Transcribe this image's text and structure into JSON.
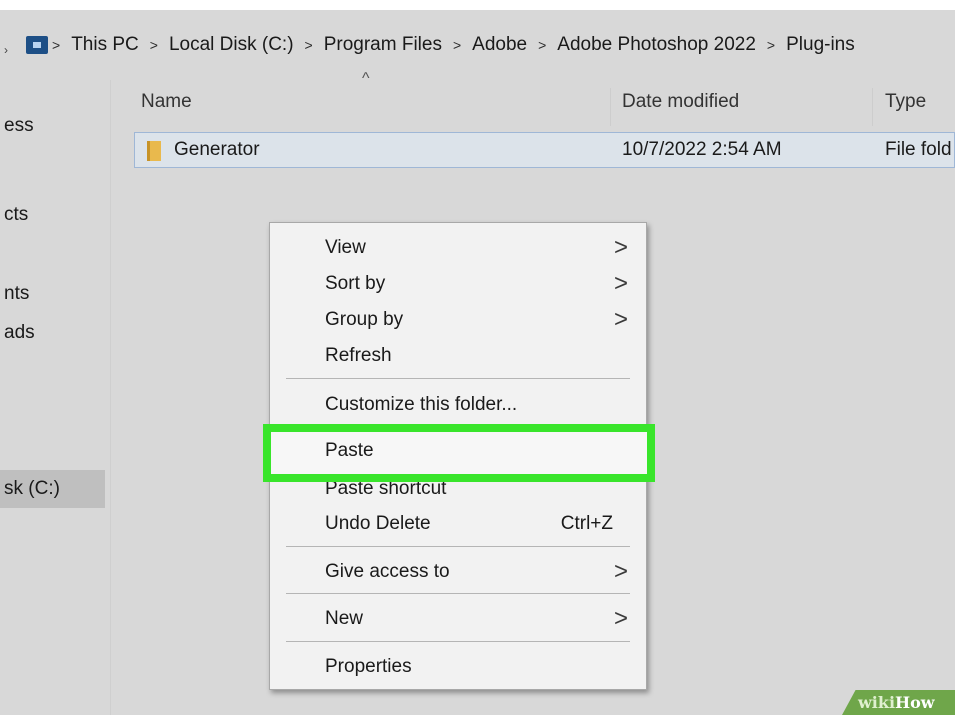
{
  "breadcrumb": {
    "items": [
      "This PC",
      "Local Disk (C:)",
      "Program Files",
      "Adobe",
      "Adobe Photoshop 2022",
      "Plug-ins"
    ]
  },
  "nav_pane": {
    "items": [
      {
        "label": "ess"
      },
      {
        "label": "cts"
      },
      {
        "label": "nts"
      },
      {
        "label": "ads"
      },
      {
        "label": "sk (C:)",
        "selected": true
      }
    ]
  },
  "columns": {
    "name": "Name",
    "date_modified": "Date modified",
    "type": "Type"
  },
  "files": [
    {
      "name": "Generator",
      "date_modified": "10/7/2022 2:54 AM",
      "type": "File fold"
    }
  ],
  "context_menu": {
    "view": "View",
    "sort_by": "Sort by",
    "group_by": "Group by",
    "refresh": "Refresh",
    "customize": "Customize this folder...",
    "paste": "Paste",
    "paste_shortcut": "Paste shortcut",
    "undo_delete": "Undo Delete",
    "undo_shortcut": "Ctrl+Z",
    "give_access": "Give access to",
    "new": "New",
    "properties": "Properties"
  },
  "highlight_color": "#39e52b",
  "watermark": {
    "part1": "wiki",
    "part2": "How"
  }
}
